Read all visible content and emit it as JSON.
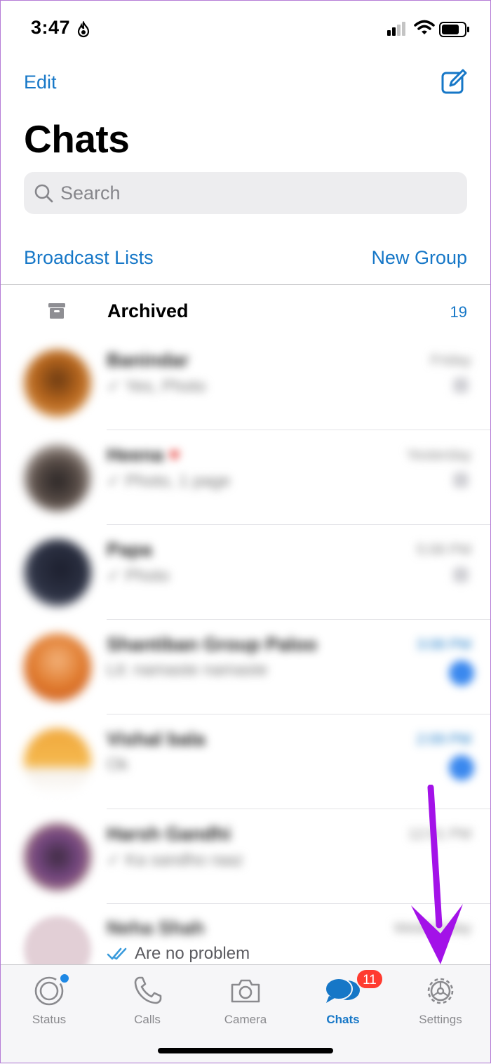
{
  "status_bar": {
    "time": "3:47"
  },
  "header": {
    "edit_label": "Edit",
    "title": "Chats"
  },
  "search": {
    "placeholder": "Search"
  },
  "actions": {
    "broadcast_label": "Broadcast Lists",
    "new_group_label": "New Group"
  },
  "archived": {
    "label": "Archived",
    "count": "19"
  },
  "chats": [
    {
      "name": "Banindar",
      "time": "Friday",
      "preview": "✓ Yes, Photo",
      "accent": "#b5651d"
    },
    {
      "name": "Heena",
      "time": "Yesterday",
      "preview": "✓ Photo, 1 page",
      "accent": "#6b5a4e"
    },
    {
      "name": "Papa",
      "time": "5:08 PM",
      "preview": "✓ Photo",
      "accent": "#2e3345"
    },
    {
      "name": "Shantiban Group Paloo",
      "time": "3:08 PM",
      "preview": "Lit: namaste namaste",
      "accent": "#e07b2e"
    },
    {
      "name": "Vishal bala",
      "time": "2:09 PM",
      "preview": "Ok",
      "accent": "#f0a83c"
    },
    {
      "name": "Harsh Gandhi",
      "time": "12:01 PM",
      "preview": "✓ Ka sandho raaz",
      "accent": "#7a4a86"
    }
  ],
  "last_chat": {
    "name": "Neha Shah",
    "time": "Wednesday",
    "preview": "Are no problem"
  },
  "tabs": [
    {
      "label": "Status",
      "icon": "status-ring-icon"
    },
    {
      "label": "Calls",
      "icon": "phone-icon"
    },
    {
      "label": "Camera",
      "icon": "camera-icon"
    },
    {
      "label": "Chats",
      "icon": "chat-bubbles-icon",
      "badge": "11"
    },
    {
      "label": "Settings",
      "icon": "gear-icon"
    }
  ],
  "colors": {
    "accent": "#1677c7",
    "badge": "#ff3b30",
    "annotation_arrow": "#a312e8"
  }
}
